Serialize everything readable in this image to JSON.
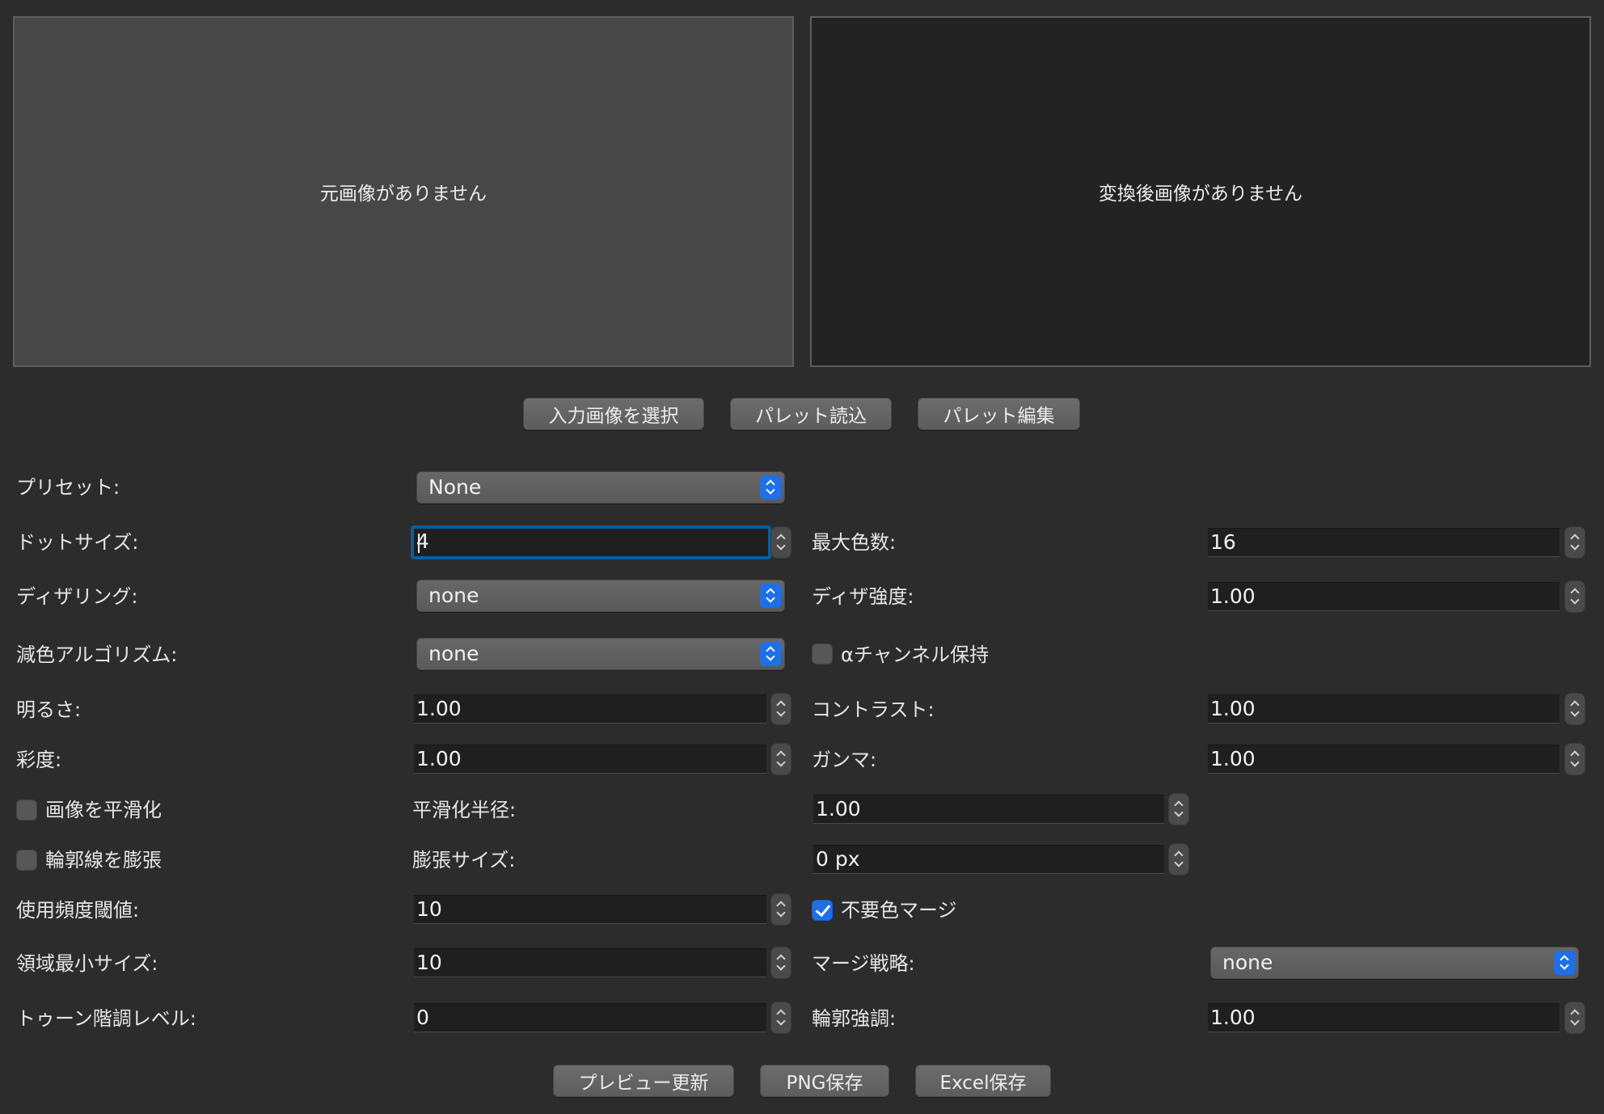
{
  "preview": {
    "source_empty": "元画像がありません",
    "result_empty": "変換後画像がありません"
  },
  "top_buttons": {
    "select_input": "入力画像を選択",
    "load_palette": "パレット読込",
    "edit_palette": "パレット編集"
  },
  "form": {
    "preset": {
      "label": "プリセット:",
      "value": "None"
    },
    "dot_size": {
      "label": "ドットサイズ:",
      "value": "4"
    },
    "max_colors": {
      "label": "最大色数:",
      "value": "16"
    },
    "dithering": {
      "label": "ディザリング:",
      "value": "none"
    },
    "dither_strength": {
      "label": "ディザ強度:",
      "value": "1.00"
    },
    "reduction_algorithm": {
      "label": "減色アルゴリズム:",
      "value": "none"
    },
    "alpha_keep": {
      "label": "αチャンネル保持",
      "checked": false
    },
    "brightness": {
      "label": "明るさ:",
      "value": "1.00"
    },
    "contrast": {
      "label": "コントラスト:",
      "value": "1.00"
    },
    "saturation": {
      "label": "彩度:",
      "value": "1.00"
    },
    "gamma": {
      "label": "ガンマ:",
      "value": "1.00"
    },
    "smooth_image": {
      "label": "画像を平滑化",
      "checked": false
    },
    "smooth_radius": {
      "label": "平滑化半径:",
      "value": "1.00"
    },
    "dilate_outline": {
      "label": "輪郭線を膨張",
      "checked": false
    },
    "dilate_size": {
      "label": "膨張サイズ:",
      "value": "0 px"
    },
    "usage_threshold": {
      "label": "使用頻度閾値:",
      "value": "10"
    },
    "merge_unused": {
      "label": "不要色マージ",
      "checked": true
    },
    "min_region_size": {
      "label": "領域最小サイズ:",
      "value": "10"
    },
    "merge_strategy": {
      "label": "マージ戦略:",
      "value": "none"
    },
    "tone_levels": {
      "label": "トゥーン階調レベル:",
      "value": "0"
    },
    "edge_enhance": {
      "label": "輪郭強調:",
      "value": "1.00"
    }
  },
  "bottom_buttons": {
    "update_preview": "プレビュー更新",
    "save_png": "PNG保存",
    "save_excel": "Excel保存"
  },
  "colors": {
    "background": "#2c2c2c",
    "accent": "#1f6fe6",
    "focus_ring": "#0a5f99"
  }
}
